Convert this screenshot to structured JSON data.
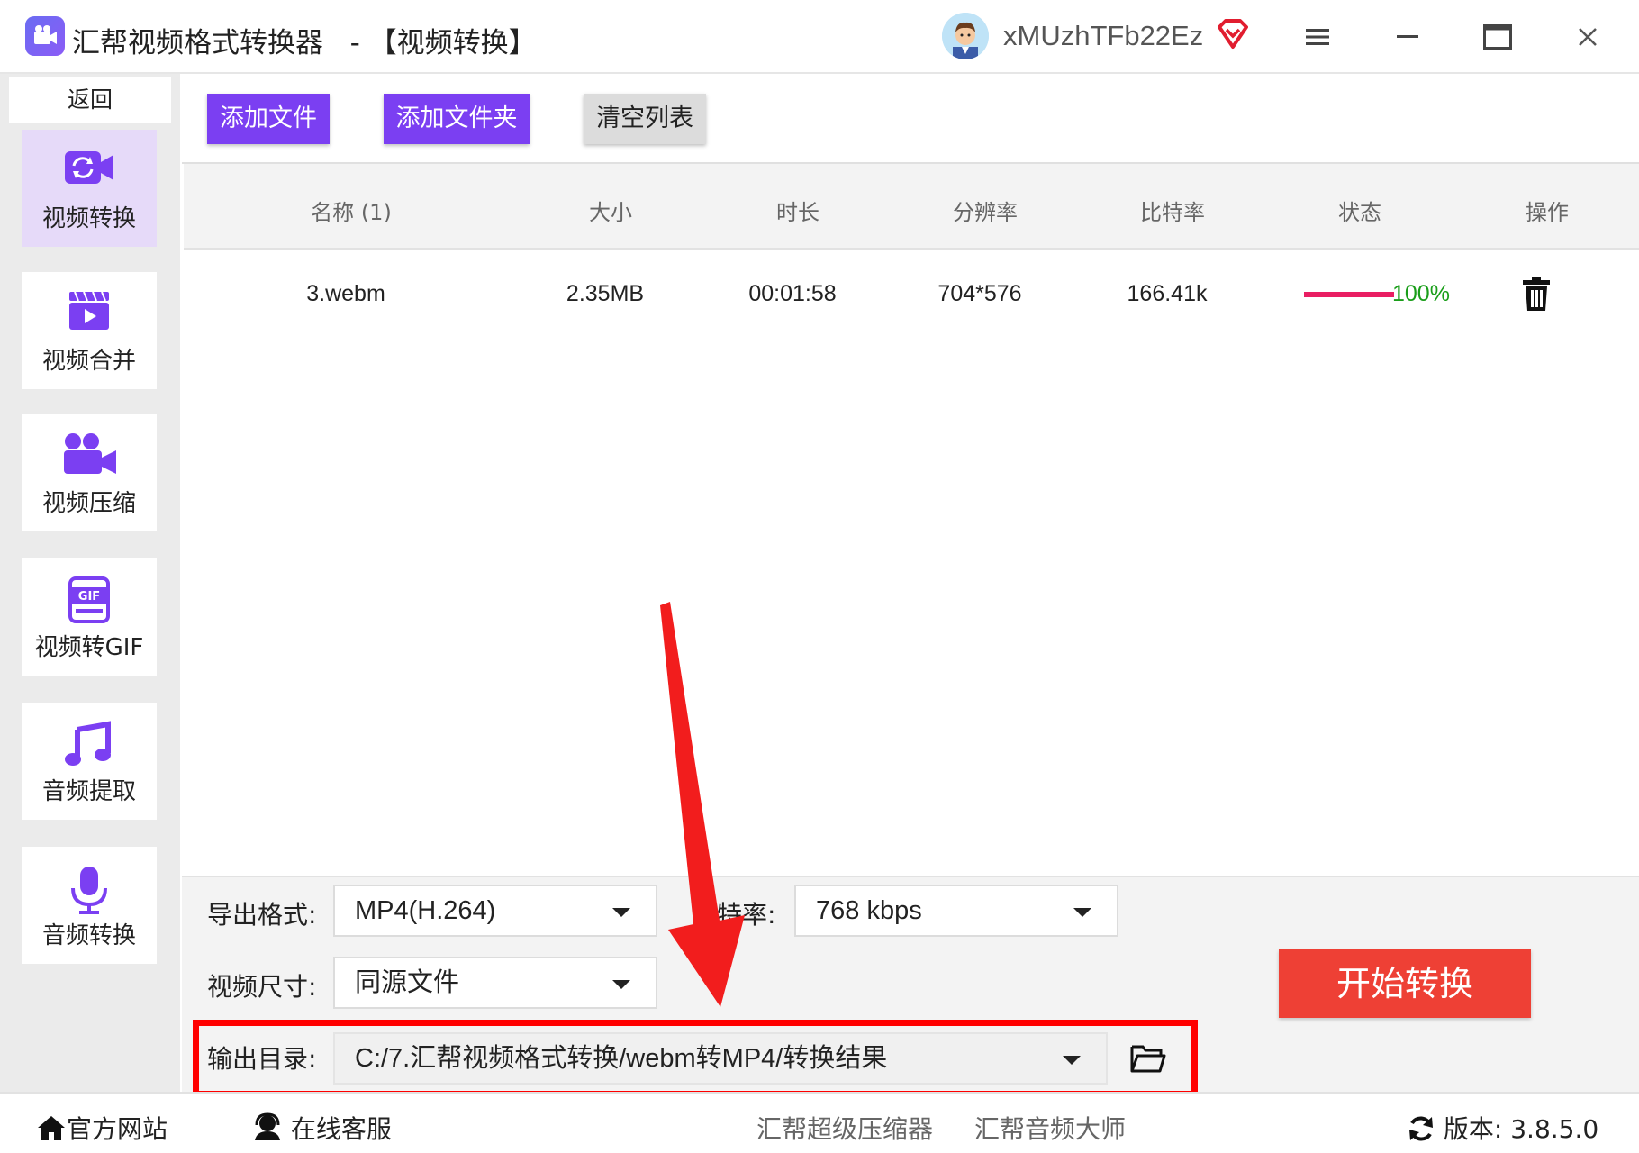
{
  "window": {
    "app_title": "汇帮视频格式转换器",
    "separator": "-",
    "section": "【视频转换】",
    "username": "xMUzhTFb22Ez"
  },
  "sidebar": {
    "back": "返回",
    "items": [
      {
        "label": "视频转换",
        "icon": "video-convert-icon",
        "active": true
      },
      {
        "label": "视频合并",
        "icon": "video-merge-icon",
        "active": false
      },
      {
        "label": "视频压缩",
        "icon": "video-compress-icon",
        "active": false
      },
      {
        "label": "视频转GIF",
        "icon": "gif-icon",
        "active": false
      },
      {
        "label": "音频提取",
        "icon": "music-note-icon",
        "active": false
      },
      {
        "label": "音频转换",
        "icon": "microphone-icon",
        "active": false
      }
    ]
  },
  "toolbar": {
    "add_file": "添加文件",
    "add_folder": "添加文件夹",
    "clear_list": "清空列表"
  },
  "table": {
    "headers": [
      "名称 (1)",
      "大小",
      "时长",
      "分辨率",
      "比特率",
      "状态",
      "操作"
    ],
    "rows": [
      {
        "name": "3.webm",
        "size": "2.35MB",
        "duration": "00:01:58",
        "resolution": "704*576",
        "bitrate": "166.41k",
        "progress_text": "100%",
        "progress": 1.0
      }
    ]
  },
  "settings": {
    "format_label": "导出格式:",
    "format_value": "MP4(H.264)",
    "bitrate_label": "特率:",
    "bitrate_value": "768 kbps",
    "size_label": "视频尺寸:",
    "size_value": "同源文件",
    "output_label": "输出目录:",
    "output_value": "C:/7.汇帮视频格式转换/webm转MP4/转换结果",
    "start_button": "开始转换"
  },
  "footer": {
    "website": "官方网站",
    "support": "在线客服",
    "link1": "汇帮超级压缩器",
    "link2": "汇帮音频大师",
    "version": "版本:  3.8.5.0"
  },
  "colors": {
    "accent": "#7b3ff2",
    "start": "#ee4035",
    "highlight": "#ff0000",
    "progress": "#e91e63",
    "status_text": "#1a9e1a"
  }
}
